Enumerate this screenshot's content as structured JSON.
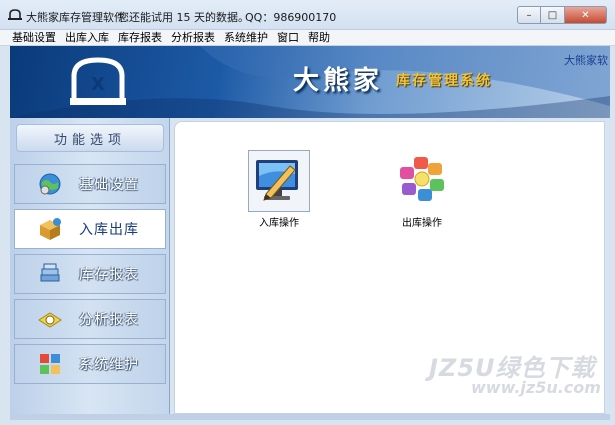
{
  "window": {
    "title": "大熊家库存管理软件",
    "trial_notice": "您还能试用 15 天的数据。",
    "qq": "QQ：986900170",
    "icon": "app-icon"
  },
  "window_controls": {
    "minimize": "–",
    "maximize": "□",
    "close": "✕"
  },
  "menu": {
    "items": [
      {
        "label": "基础设置"
      },
      {
        "label": "出库入库"
      },
      {
        "label": "库存报表"
      },
      {
        "label": "分析报表"
      },
      {
        "label": "系统维护"
      },
      {
        "label": "窗口"
      },
      {
        "label": "帮助"
      }
    ]
  },
  "banner": {
    "brand": "大熊家",
    "subtitle": "库存管理系统",
    "marquee": "大熊家软"
  },
  "sidebar": {
    "header": "功能选项",
    "items": [
      {
        "label": "基础设置",
        "icon": "globe-settings-icon"
      },
      {
        "label": "入库出库",
        "icon": "box-icon",
        "active": true
      },
      {
        "label": "库存报表",
        "icon": "report-stack-icon"
      },
      {
        "label": "分析报表",
        "icon": "analysis-icon"
      },
      {
        "label": "系统维护",
        "icon": "puzzle-icon"
      }
    ]
  },
  "content": {
    "tiles": [
      {
        "label": "入库操作",
        "icon": "monitor-pencil-icon",
        "selected": true
      },
      {
        "label": "出库操作",
        "icon": "colored-cubes-icon",
        "selected": false
      }
    ]
  },
  "watermark": {
    "text": "JZ5U绿色下载",
    "url": "www.jz5u.com"
  },
  "colors": {
    "banner_dark": "#0a3a7a",
    "brand_gold": "#f0c43a",
    "sidebar_blue": "#bed2ea",
    "close_red": "#c54a32"
  }
}
